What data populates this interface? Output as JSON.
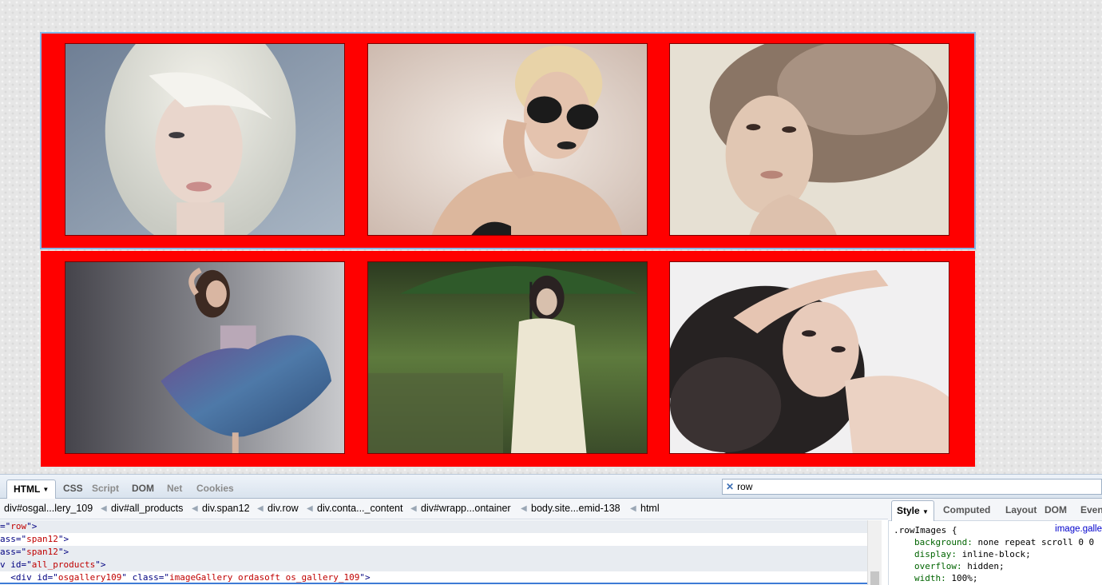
{
  "gallery": {
    "rows": [
      {
        "photos": [
          {
            "name": "platinum-blonde-portrait"
          },
          {
            "name": "woman-with-sunglasses"
          },
          {
            "name": "voluminous-hair-portrait"
          }
        ]
      },
      {
        "photos": [
          {
            "name": "woman-in-blue-dress"
          },
          {
            "name": "woman-with-umbrella"
          },
          {
            "name": "curly-hair-lying-down"
          }
        ]
      }
    ]
  },
  "devtools": {
    "tabs": [
      {
        "label": "HTML",
        "active": true
      },
      {
        "label": "CSS"
      },
      {
        "label": "Script"
      },
      {
        "label": "DOM"
      },
      {
        "label": "Net"
      },
      {
        "label": "Cookies"
      }
    ],
    "search": {
      "clear_glyph": "✕",
      "value": "row"
    },
    "breadcrumbs": [
      "div#osgal...lery_109",
      "div#all_products",
      "div.span12",
      "div.row",
      "div.conta..._content",
      "div#wrapp...ontainer",
      "body.site...emid-138",
      "html"
    ],
    "html_lines": [
      {
        "pre": "=\"",
        "value": "row",
        "post": "\">"
      },
      {
        "pre": "ass=\"",
        "value": "span12",
        "post": "\">"
      },
      {
        "pre": "ass=\"",
        "value": "span12",
        "post": "\">"
      },
      {
        "pre": "v id=\"",
        "value": "all_products",
        "post": "\">"
      },
      {
        "pre": "  <div id=\"",
        "value": "osgallery109",
        "mid": "\" class=\"",
        "value2": "imageGallery ordasoft os_gallery_109",
        "post": "\">"
      }
    ],
    "side_tabs": [
      {
        "label": "Style",
        "active": true
      },
      {
        "label": "Computed"
      },
      {
        "label": "Layout"
      },
      {
        "label": "DOM"
      },
      {
        "label": "Even"
      }
    ],
    "style": {
      "selector": ".rowImages {",
      "source": "image.galle",
      "rules": [
        {
          "prop": "background:",
          "value": "none repeat scroll 0 0"
        },
        {
          "prop": "display:",
          "value": "inline-block;"
        },
        {
          "prop": "overflow:",
          "value": "hidden;"
        },
        {
          "prop": "width:",
          "value": "100%;"
        }
      ]
    }
  },
  "colors": {
    "gallery_row_bg": "#ff0000",
    "selection_outline": "#86b6e6"
  }
}
